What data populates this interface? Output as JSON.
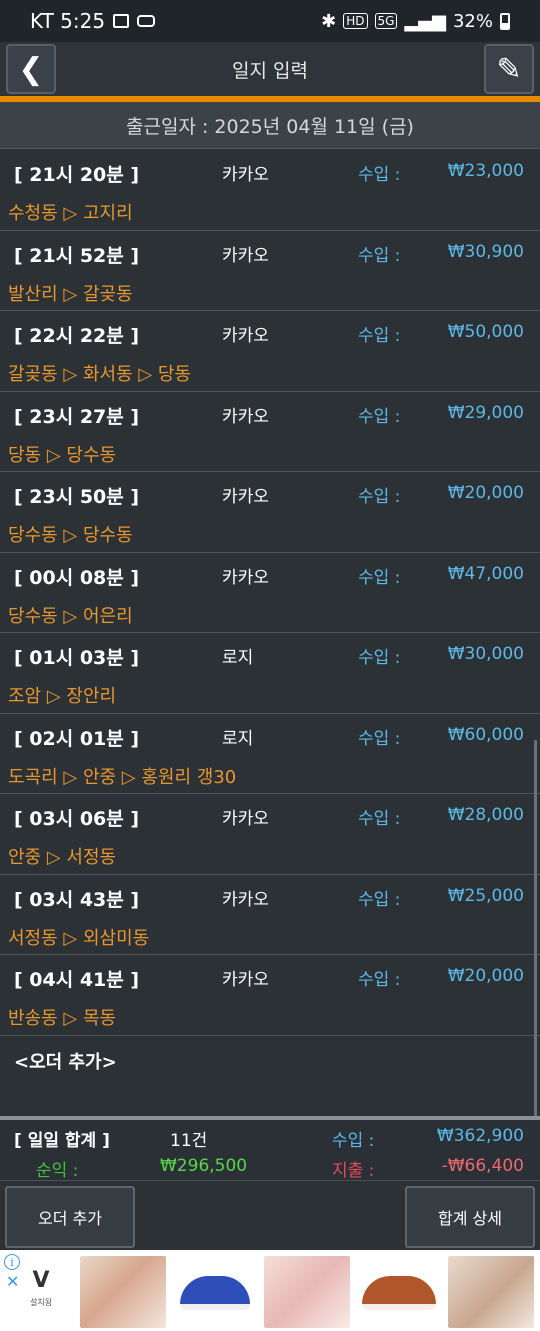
{
  "status_bar": {
    "carrier_time": "KT 5:25",
    "hd": "HD",
    "net": "5G",
    "battery": "32%"
  },
  "header": {
    "back_glyph": "❮",
    "title": "일지 입력",
    "edit_glyph": "✎"
  },
  "date_bar": {
    "text": "출근일자 : 2025년 04월 11일 (금)"
  },
  "orders": [
    {
      "time": "[ 21시 20분 ]",
      "company": "카카오",
      "income_label": "수입 :",
      "amount": "₩23,000",
      "route": "수청동 ▷ 고지리"
    },
    {
      "time": "[ 21시 52분 ]",
      "company": "카카오",
      "income_label": "수입 :",
      "amount": "₩30,900",
      "route": "발산리 ▷ 갈곶동"
    },
    {
      "time": "[ 22시 22분 ]",
      "company": "카카오",
      "income_label": "수입 :",
      "amount": "₩50,000",
      "route": "갈곶동 ▷ 화서동 ▷ 당동"
    },
    {
      "time": "[ 23시 27분 ]",
      "company": "카카오",
      "income_label": "수입 :",
      "amount": "₩29,000",
      "route": "당동 ▷ 당수동"
    },
    {
      "time": "[ 23시 50분 ]",
      "company": "카카오",
      "income_label": "수입 :",
      "amount": "₩20,000",
      "route": "당수동 ▷ 당수동"
    },
    {
      "time": "[ 00시 08분 ]",
      "company": "카카오",
      "income_label": "수입 :",
      "amount": "₩47,000",
      "route": "당수동 ▷ 어은리"
    },
    {
      "time": "[ 01시 03분 ]",
      "company": "로지",
      "income_label": "수입 :",
      "amount": "₩30,000",
      "route": "조암 ▷ 장안리"
    },
    {
      "time": "[ 02시 01분 ]",
      "company": "로지",
      "income_label": "수입 :",
      "amount": "₩60,000",
      "route": "도곡리 ▷ 안중 ▷ 홍원리  갱30"
    },
    {
      "time": "[ 03시 06분 ]",
      "company": "카카오",
      "income_label": "수입 :",
      "amount": "₩28,000",
      "route": "안중 ▷ 서정동"
    },
    {
      "time": "[ 03시 43분 ]",
      "company": "카카오",
      "income_label": "수입 :",
      "amount": "₩25,000",
      "route": "서정동 ▷ 외삼미동"
    },
    {
      "time": "[ 04시 41분 ]",
      "company": "카카오",
      "income_label": "수입 :",
      "amount": "₩20,000",
      "route": "반송동 ▷ 목동"
    }
  ],
  "add_order_row": "<오더 추가>",
  "summary": {
    "title": "[ 일일 합계 ]",
    "count": "11건",
    "income_label": "수입 :",
    "income": "₩362,900",
    "net_label": "순익 :",
    "net": "₩296,500",
    "expense_label": "지출 :",
    "expense": "-₩66,400"
  },
  "buttons": {
    "add_order": "오더 추가",
    "total_detail": "합계 상세"
  },
  "ad": {
    "info_glyph": "i",
    "close_glyph": "✕",
    "logo_mark": "V",
    "brand": "설치됨"
  },
  "colors": {
    "accent_orange": "#e68a00",
    "income_blue": "#5cb8e6",
    "route_orange": "#e8962e",
    "net_green": "#56d64a",
    "expense_red": "#e86a70"
  },
  "icons": [
    "back-arrow-icon",
    "pencil-icon",
    "bluetooth-icon",
    "signal-icon",
    "battery-icon",
    "gallery-icon",
    "voicemail-icon"
  ]
}
